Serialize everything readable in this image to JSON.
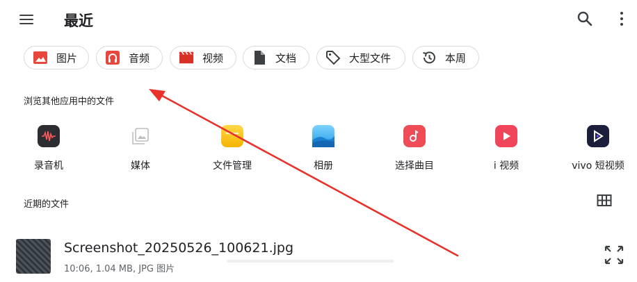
{
  "header": {
    "title": "最近",
    "menu_icon": "hamburger-menu-icon",
    "search_icon": "search-icon",
    "more_icon": "more-vertical-icon"
  },
  "chips": [
    {
      "label": "图片",
      "icon": "image-icon",
      "color": "#e8473c"
    },
    {
      "label": "音频",
      "icon": "headphones-icon",
      "color": "#e8473c"
    },
    {
      "label": "视频",
      "icon": "movie-icon",
      "color": "#d93025"
    },
    {
      "label": "文档",
      "icon": "document-icon",
      "color": "#3c4043"
    },
    {
      "label": "大型文件",
      "icon": "tag-icon",
      "color": "#3c4043"
    },
    {
      "label": "本周",
      "icon": "history-icon",
      "color": "#3c4043"
    }
  ],
  "other_apps": {
    "title": "浏览其他应用中的文件",
    "apps": [
      {
        "label": "录音机",
        "icon": "recorder-app-icon"
      },
      {
        "label": "媒体",
        "icon": "media-app-icon"
      },
      {
        "label": "文件管理",
        "icon": "file-manager-app-icon"
      },
      {
        "label": "相册",
        "icon": "gallery-app-icon"
      },
      {
        "label": "选择曲目",
        "icon": "music-app-icon"
      },
      {
        "label": "i 视频",
        "icon": "i-video-app-icon"
      },
      {
        "label": "vivo 短视频",
        "icon": "vivo-short-video-app-icon"
      }
    ]
  },
  "recent": {
    "title": "近期的文件",
    "view_toggle_icon": "grid-view-icon",
    "files": [
      {
        "name": "Screenshot_20250526_100621.jpg",
        "meta": "10:06, 1.04 MB, JPG 图片",
        "icon": "expand-icon"
      }
    ]
  },
  "annotation": {
    "type": "arrow",
    "color": "#e8312a"
  }
}
